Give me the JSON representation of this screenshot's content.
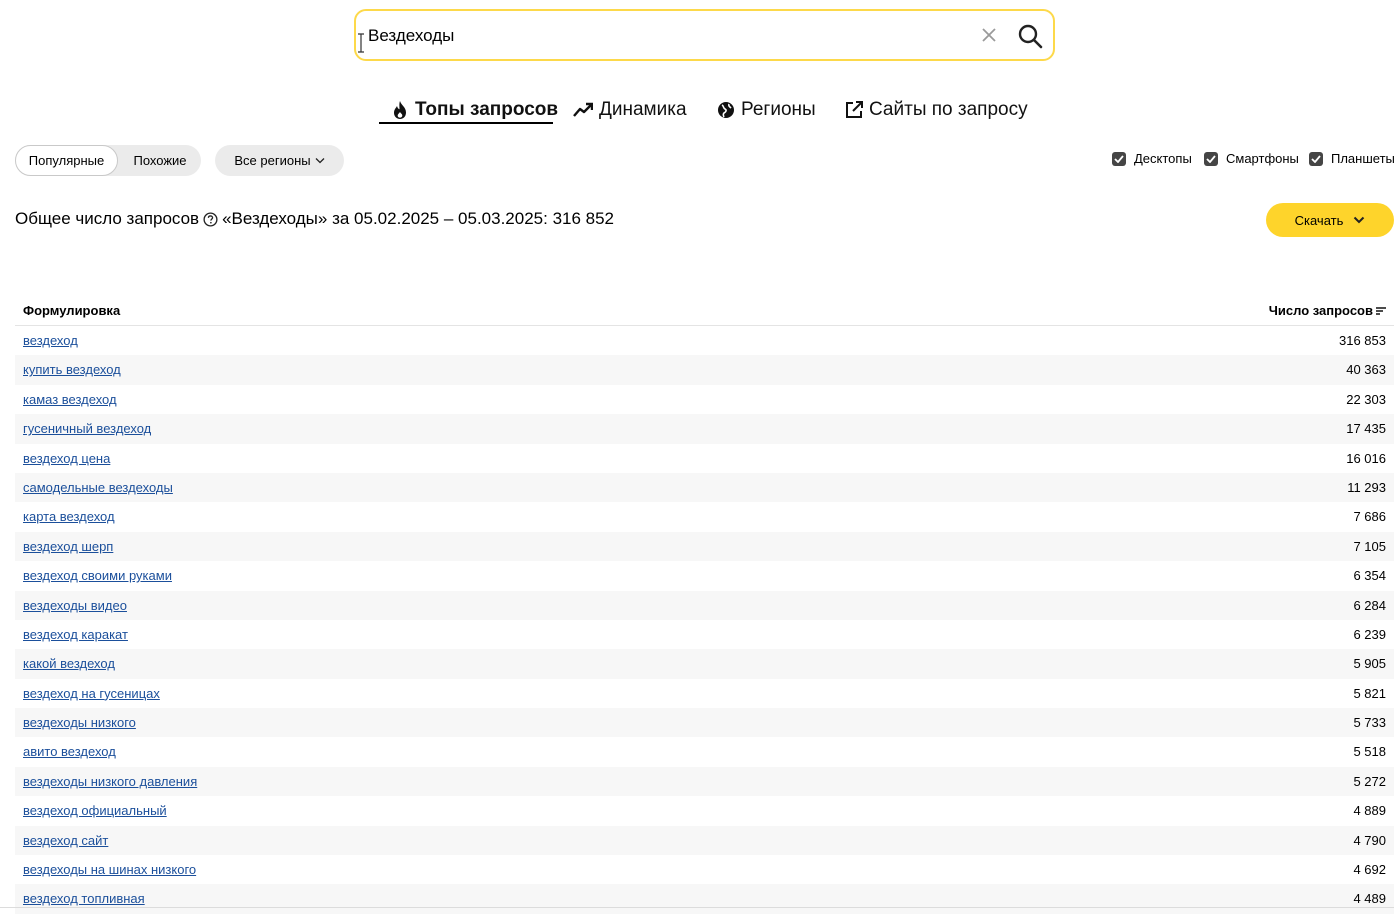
{
  "search": {
    "value": "Вездеходы"
  },
  "tabs": [
    {
      "label": "Топы запросов",
      "icon": "fire-icon"
    },
    {
      "label": "Динамика",
      "icon": "trend-icon"
    },
    {
      "label": "Регионы",
      "icon": "globe-icon"
    },
    {
      "label": "Сайты по запросу",
      "icon": "external-link-icon"
    }
  ],
  "filters": {
    "popular": "Популярные",
    "similar": "Похожие",
    "regions": "Все регионы"
  },
  "devices": {
    "desktops": "Десктопы",
    "smartphones": "Смартфоны",
    "tablets": "Планшеты"
  },
  "summary": {
    "prefix": "Общее число запросов",
    "suffix": "«Вездеходы» за 05.02.2025 – 05.03.2025: 316 852"
  },
  "download": {
    "label": "Скачать"
  },
  "table": {
    "col_phrase": "Формулировка",
    "col_count": "Число запросов",
    "rows": [
      {
        "phrase": "вездеход",
        "count": "316 853"
      },
      {
        "phrase": "купить вездеход",
        "count": "40 363"
      },
      {
        "phrase": "камаз вездеход",
        "count": "22 303"
      },
      {
        "phrase": "гусеничный вездеход",
        "count": "17 435"
      },
      {
        "phrase": "вездеход цена",
        "count": "16 016"
      },
      {
        "phrase": "самодельные вездеходы",
        "count": "11 293"
      },
      {
        "phrase": "карта вездеход",
        "count": "7 686"
      },
      {
        "phrase": "вездеход шерп",
        "count": "7 105"
      },
      {
        "phrase": "вездеход своими руками",
        "count": "6 354"
      },
      {
        "phrase": "вездеходы видео",
        "count": "6 284"
      },
      {
        "phrase": "вездеход каракат",
        "count": "6 239"
      },
      {
        "phrase": "какой вездеход",
        "count": "5 905"
      },
      {
        "phrase": "вездеход на гусеницах",
        "count": "5 821"
      },
      {
        "phrase": "вездеходы низкого",
        "count": "5 733"
      },
      {
        "phrase": "авито вездеход",
        "count": "5 518"
      },
      {
        "phrase": "вездеходы низкого давления",
        "count": "5 272"
      },
      {
        "phrase": "вездеход официальный",
        "count": "4 889"
      },
      {
        "phrase": "вездеход сайт",
        "count": "4 790"
      },
      {
        "phrase": "вездеходы на шинах низкого",
        "count": "4 692"
      },
      {
        "phrase": "вездеход топливная",
        "count": "4 489"
      }
    ]
  }
}
